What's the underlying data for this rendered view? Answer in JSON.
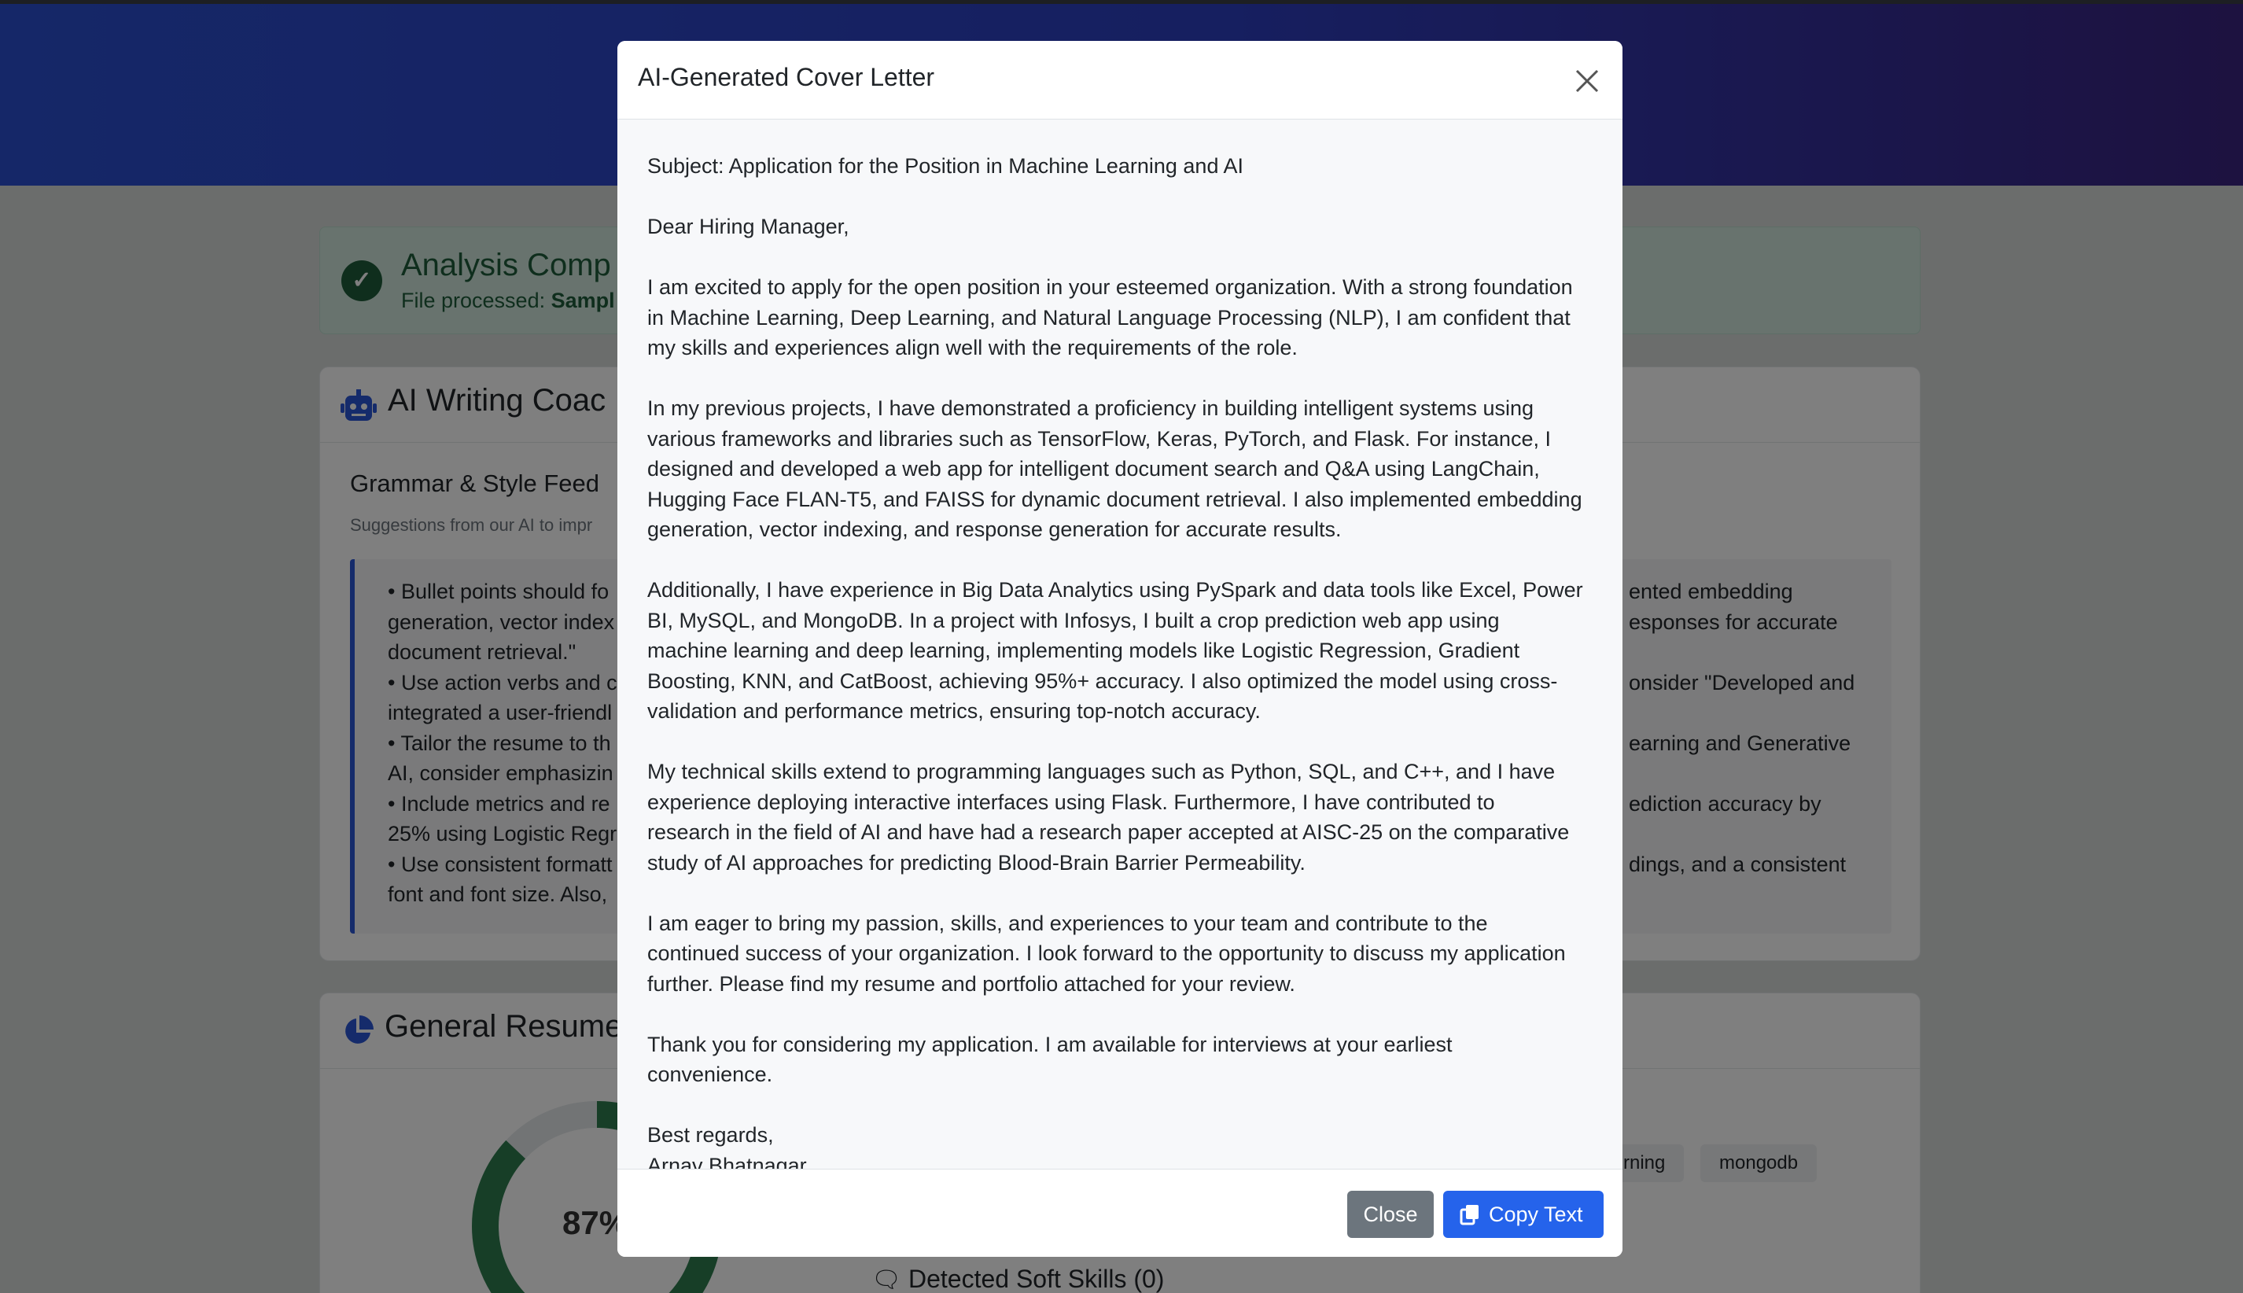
{
  "background": {
    "alert": {
      "title": "Analysis Comp",
      "sub_label": "File processed: ",
      "sub_file": "Sampl"
    },
    "coach": {
      "title": "AI Writing Coac",
      "section_title": "Grammar & Style Feed",
      "section_sub": "Suggestions from our AI to impr",
      "feedback_left": "• Bullet points should fo\ngeneration, vector index\ndocument retrieval.\"\n• Use action verbs and c\nintegrated a user-friendl\n• Tailor the resume to th\nAI, consider emphasizin\n• Include metrics and re\n25% using Logistic Regr\n• Use consistent formatt\nfont and font size. Also,",
      "feedback_right": "ented embedding\nesponses for accurate\n\nonsider \"Developed and\n\nearning and Generative\n\nediction accuracy by\n\ndings, and a consistent"
    },
    "summary": {
      "title": "General Resume",
      "score": "87%",
      "score_value": 87,
      "chips": [
        "rning",
        "mongodb"
      ],
      "soft_skills": "Detected Soft Skills (0)"
    }
  },
  "modal": {
    "title": "AI-Generated Cover Letter",
    "close_icon": "close-icon",
    "letter": "Subject: Application for the Position in Machine Learning and AI\n\nDear Hiring Manager,\n\nI am excited to apply for the open position in your esteemed organization. With a strong foundation\nin Machine Learning, Deep Learning, and Natural Language Processing (NLP), I am confident that\nmy skills and experiences align well with the requirements of the role.\n\nIn my previous projects, I have demonstrated a proficiency in building intelligent systems using\nvarious frameworks and libraries such as TensorFlow, Keras, PyTorch, and Flask. For instance, I\ndesigned and developed a web app for intelligent document search and Q&A using LangChain,\nHugging Face FLAN-T5, and FAISS for dynamic document retrieval. I also implemented embedding\ngeneration, vector indexing, and response generation for accurate results.\n\nAdditionally, I have experience in Big Data Analytics using PySpark and data tools like Excel, Power\nBI, MySQL, and MongoDB. In a project with Infosys, I built a crop prediction web app using\nmachine learning and deep learning, implementing models like Logistic Regression, Gradient\nBoosting, KNN, and CatBoost, achieving 95%+ accuracy. I also optimized the model using cross-\nvalidation and performance metrics, ensuring top-notch accuracy.\n\nMy technical skills extend to programming languages such as Python, SQL, and C++, and I have\nexperience deploying interactive interfaces using Flask. Furthermore, I have contributed to\nresearch in the field of AI and have had a research paper accepted at AISC-25 on the comparative\nstudy of AI approaches for predicting Blood-Brain Barrier Permeability.\n\nI am eager to bring my passion, skills, and experiences to your team and contribute to the\ncontinued success of your organization. I look forward to the opportunity to discuss my application\nfurther. Please find my resume and portfolio attached for your review.\n\nThank you for considering my application. I am available for interviews at your earliest\nconvenience.\n\nBest regards,\nArnav Bhatnagar",
    "buttons": {
      "close_label": "Close",
      "copy_label": "Copy Text",
      "copy_icon": "copy-icon"
    }
  },
  "colors": {
    "primary": "#2563eb",
    "secondary": "#6c757d",
    "success_text": "#1f5d3b",
    "success_bg": "#d1e7dd",
    "donut_fill": "#2e7d4f"
  }
}
